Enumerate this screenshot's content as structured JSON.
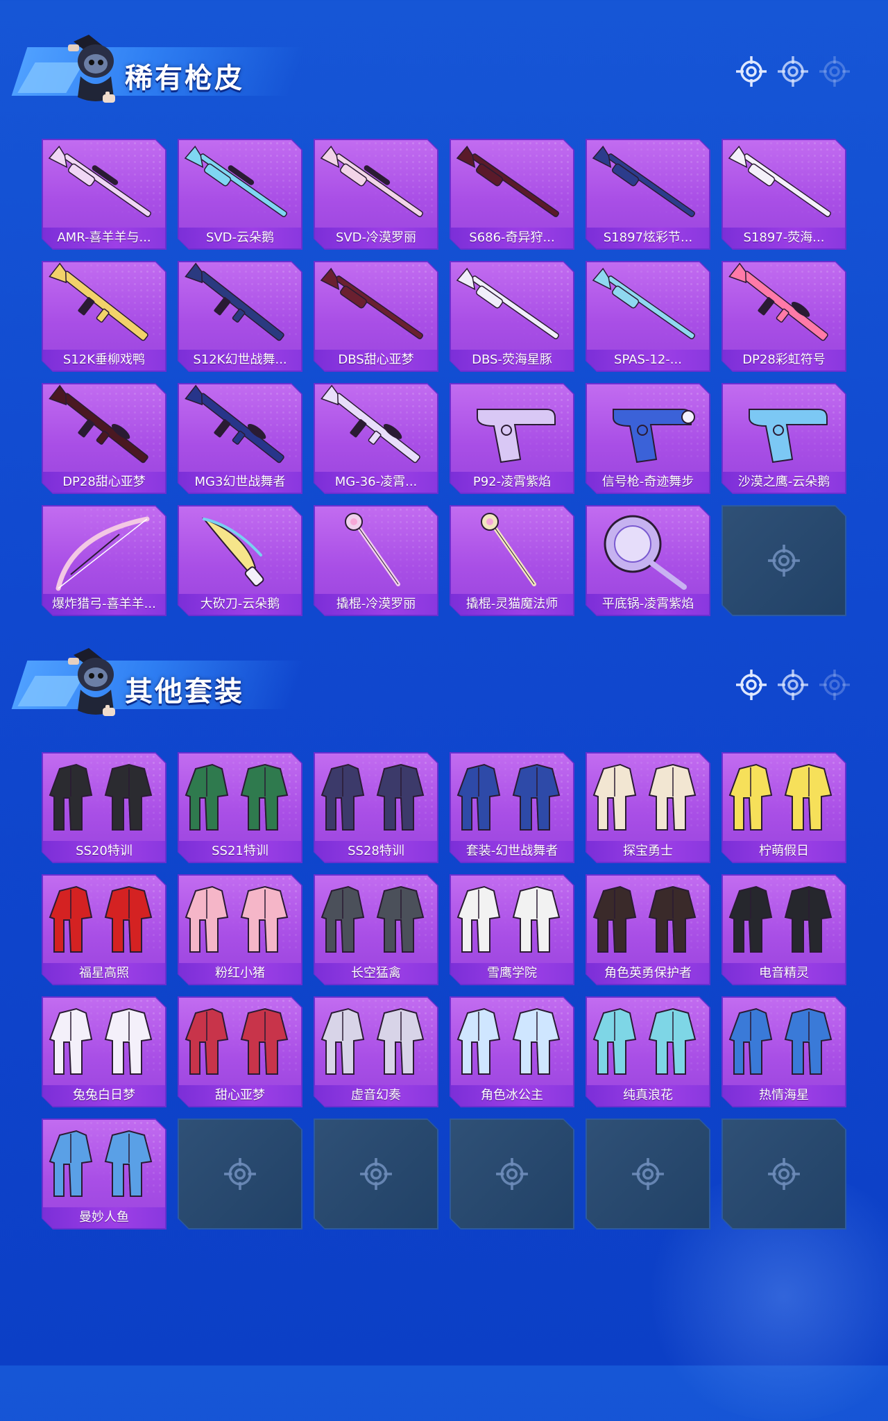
{
  "colors": {
    "background": "#1152d4",
    "card": "#b15ae9",
    "label_bar": "#8e3be0",
    "empty_card": "#24476f",
    "title_shadow": "#0a2a8a"
  },
  "sections": [
    {
      "title": "稀有枪皮",
      "items": [
        {
          "label": "AMR-喜羊羊与...",
          "icon": "sniper-rifle-icon",
          "color": "#f0d7f5"
        },
        {
          "label": "SVD-云朵鹅",
          "icon": "sniper-rifle-icon",
          "color": "#7fd6f2"
        },
        {
          "label": "SVD-冷漠罗丽",
          "icon": "sniper-rifle-icon",
          "color": "#f2d4e8"
        },
        {
          "label": "S686-奇异狩...",
          "icon": "shotgun-icon",
          "color": "#5a1a2a"
        },
        {
          "label": "S1897炫彩节...",
          "icon": "shotgun-icon",
          "color": "#2c3c8c"
        },
        {
          "label": "S1897-荧海...",
          "icon": "shotgun-icon",
          "color": "#f4f0fa"
        },
        {
          "label": "S12K垂柳戏鸭",
          "icon": "assault-rifle-icon",
          "color": "#f2d26a"
        },
        {
          "label": "S12K幻世战舞...",
          "icon": "assault-rifle-icon",
          "color": "#2a3a80"
        },
        {
          "label": "DBS甜心亚梦",
          "icon": "shotgun-icon",
          "color": "#6a2030"
        },
        {
          "label": "DBS-荧海星豚",
          "icon": "shotgun-icon",
          "color": "#f0eefa"
        },
        {
          "label": "SPAS-12-...",
          "icon": "shotgun-icon",
          "color": "#8fd8f0"
        },
        {
          "label": "DP28彩虹符号",
          "icon": "machine-gun-icon",
          "color": "#ff7aa8"
        },
        {
          "label": "DP28甜心亚梦",
          "icon": "machine-gun-icon",
          "color": "#4a1822"
        },
        {
          "label": "MG3幻世战舞者",
          "icon": "machine-gun-icon",
          "color": "#27358a"
        },
        {
          "label": "MG-36-凌霄...",
          "icon": "machine-gun-icon",
          "color": "#e8defa"
        },
        {
          "label": "P92-凌霄紫焰",
          "icon": "pistol-icon",
          "color": "#d9c8f5"
        },
        {
          "label": "信号枪-奇迹舞步",
          "icon": "flare-gun-icon",
          "color": "#3b62d8"
        },
        {
          "label": "沙漠之鹰-云朵鹅",
          "icon": "pistol-icon",
          "color": "#7cc8f4"
        },
        {
          "label": "爆炸猎弓-喜羊羊...",
          "icon": "bow-icon",
          "color": "#f3c8e4"
        },
        {
          "label": "大砍刀-云朵鹅",
          "icon": "machete-icon",
          "color": "#f6e58a"
        },
        {
          "label": "撬棍-冷漠罗丽",
          "icon": "scepter-icon",
          "color": "#f0d0ec"
        },
        {
          "label": "撬棍-灵猫魔法师",
          "icon": "scepter-icon",
          "color": "#f2e6c0"
        },
        {
          "label": "平底锅-凌霄紫焰",
          "icon": "pan-icon",
          "color": "#c6b2f0"
        }
      ],
      "empty_slots": 1
    },
    {
      "title": "其他套装",
      "items": [
        {
          "label": "SS20特训",
          "icon": "outfit-icon",
          "color": "#2b2b30"
        },
        {
          "label": "SS21特训",
          "icon": "outfit-icon",
          "color": "#2f7a4e"
        },
        {
          "label": "SS28特训",
          "icon": "outfit-icon",
          "color": "#3c3a6a"
        },
        {
          "label": "套装-幻世战舞者",
          "icon": "outfit-icon",
          "color": "#2e4aa8"
        },
        {
          "label": "探宝勇士",
          "icon": "outfit-icon",
          "color": "#f2e6d2"
        },
        {
          "label": "柠萌假日",
          "icon": "outfit-icon",
          "color": "#f6e05a"
        },
        {
          "label": "福星高照",
          "icon": "outfit-icon",
          "color": "#d42222"
        },
        {
          "label": "粉红小猪",
          "icon": "outfit-icon",
          "color": "#f5b6c8"
        },
        {
          "label": "长空猛禽",
          "icon": "outfit-icon",
          "color": "#4b505a"
        },
        {
          "label": "雪鹰学院",
          "icon": "outfit-icon",
          "color": "#f2f2f2"
        },
        {
          "label": "角色英勇保护者",
          "icon": "outfit-icon",
          "color": "#3a2a2a"
        },
        {
          "label": "电音精灵",
          "icon": "outfit-icon",
          "color": "#26272d"
        },
        {
          "label": "兔兔白日梦",
          "icon": "outfit-icon",
          "color": "#f4f0fa"
        },
        {
          "label": "甜心亚梦",
          "icon": "outfit-icon",
          "color": "#c8344a"
        },
        {
          "label": "虚音幻奏",
          "icon": "outfit-icon",
          "color": "#d8d4e8"
        },
        {
          "label": "角色冰公主",
          "icon": "outfit-icon",
          "color": "#cfe6ff"
        },
        {
          "label": "纯真浪花",
          "icon": "outfit-icon",
          "color": "#7ed6e6"
        },
        {
          "label": "热情海星",
          "icon": "outfit-icon",
          "color": "#3a7ad8"
        },
        {
          "label": "曼妙人鱼",
          "icon": "outfit-icon",
          "color": "#5aa0e6"
        }
      ],
      "empty_slots": 5
    }
  ]
}
